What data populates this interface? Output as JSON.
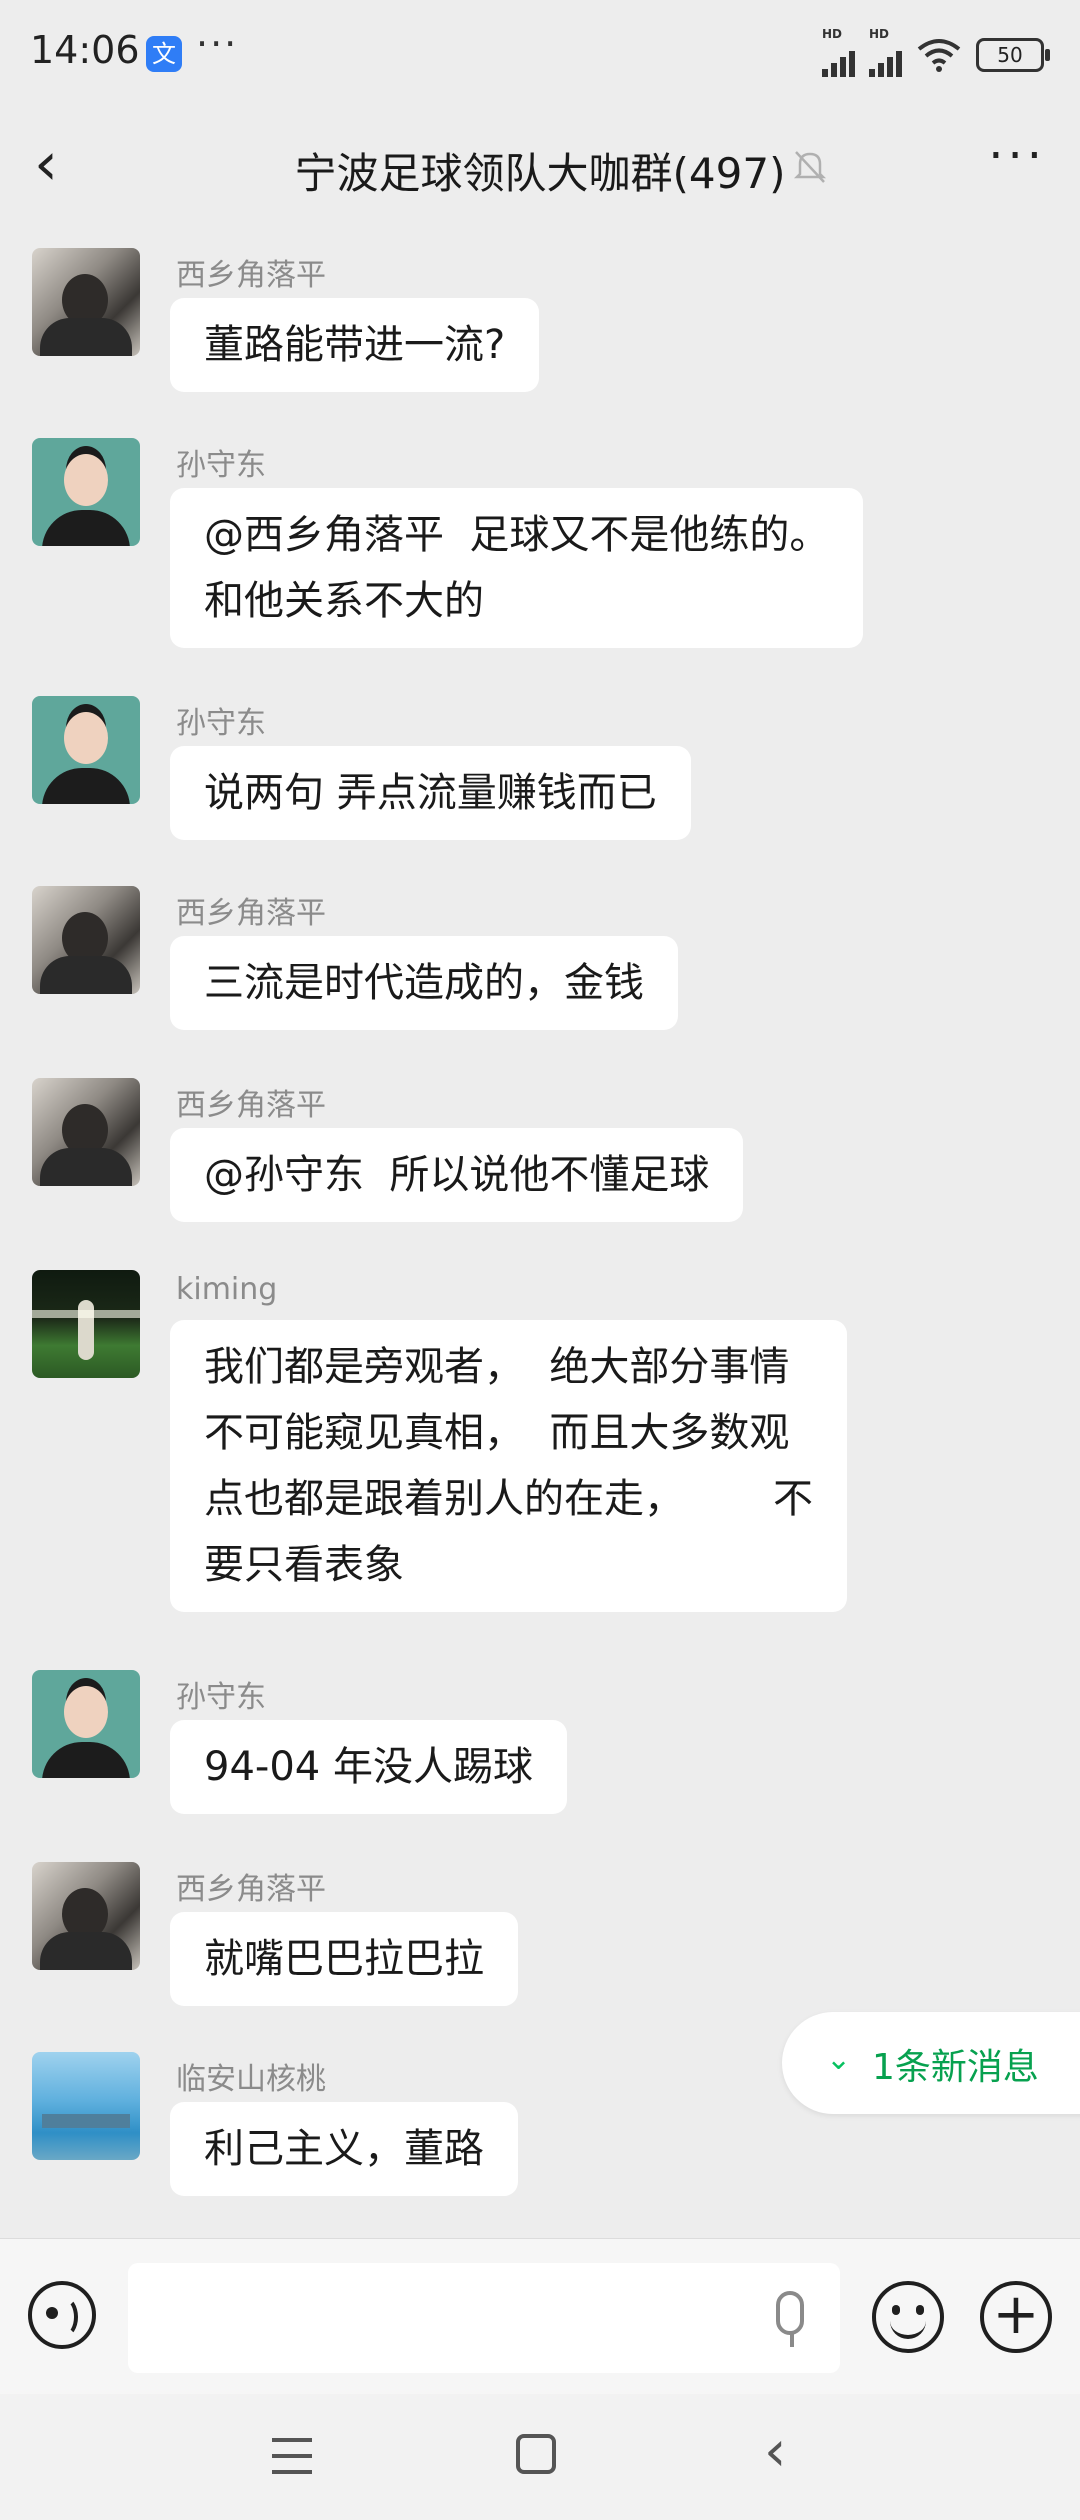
{
  "status_bar": {
    "time": "14:06",
    "app_icon_glyph": "文",
    "more": "···",
    "battery": "50"
  },
  "header": {
    "title": "宁波足球领队大咖群(497)"
  },
  "messages": [
    {
      "sender": "西乡角落平",
      "text": "董路能带进一流?",
      "avatar": "photo"
    },
    {
      "sender": "孙守东",
      "text": "@西乡角落平  足球又不是他练的。\n和他关系不大的",
      "avatar": "man"
    },
    {
      "sender": "孙守东",
      "text": "说两句 弄点流量赚钱而已",
      "avatar": "man"
    },
    {
      "sender": "西乡角落平",
      "text": "三流是时代造成的，金钱",
      "avatar": "photo"
    },
    {
      "sender": "西乡角落平",
      "text": "@孙守东  所以说他不懂足球",
      "avatar": "photo"
    },
    {
      "sender": "kiming",
      "text": "我们都是旁观者，  绝大部分事情\n不可能窥见真相，  而且大多数观\n点也都是跟着别人的在走，       不\n要只看表象",
      "avatar": "stadium"
    },
    {
      "sender": "孙守东",
      "text": "94-04 年没人踢球",
      "avatar": "man"
    },
    {
      "sender": "西乡角落平",
      "text": "就嘴巴巴拉巴拉",
      "avatar": "photo"
    },
    {
      "sender": "临安山核桃",
      "text": "利己主义，董路",
      "avatar": "sky"
    }
  ],
  "new_message_pill": {
    "icon": "double-chevron-down-icon",
    "label": "1条新消息"
  },
  "input": {
    "value": "",
    "placeholder": ""
  },
  "colors": {
    "background": "#ededed",
    "bubble": "#ffffff",
    "accent_green": "#07c160"
  }
}
